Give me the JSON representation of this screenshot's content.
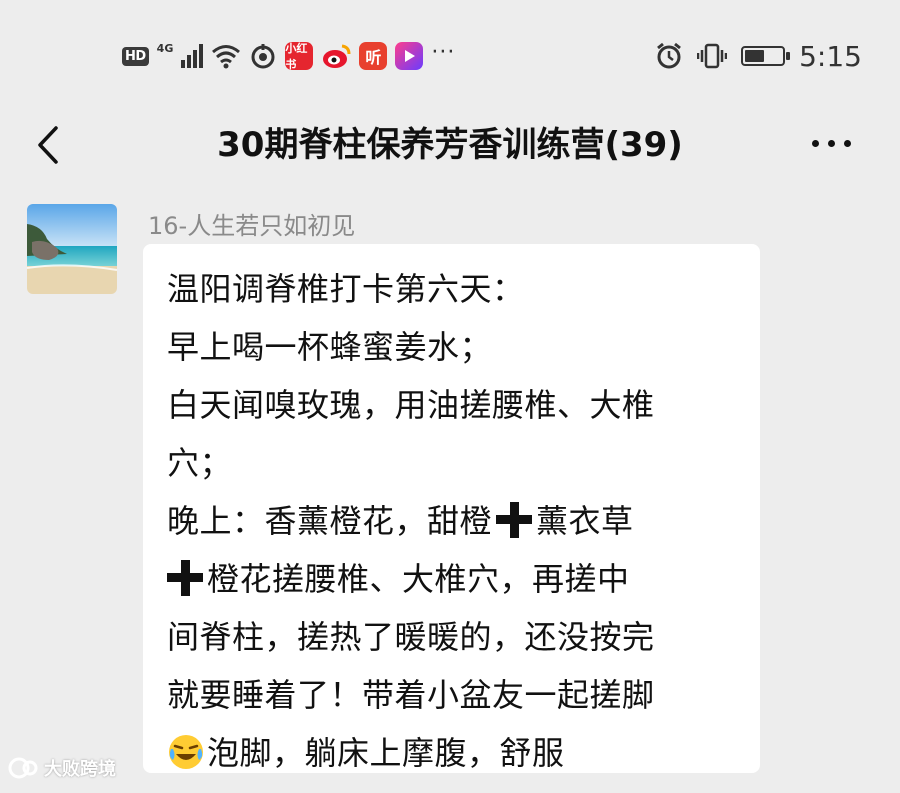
{
  "status_bar": {
    "hd_label": "HD",
    "network_label": "4G",
    "icons": [
      "signal-icon",
      "wifi-icon",
      "hotspot-icon",
      "app-xiaohongshu-icon",
      "weibo-icon",
      "listen-icon",
      "video-app-icon",
      "more-notifications-icon",
      "alarm-icon",
      "vibrate-icon",
      "battery-icon"
    ],
    "app_labels": [
      "小红书",
      "听"
    ],
    "overflow": "···",
    "battery_level": 0.55,
    "time": "5:15"
  },
  "header": {
    "back_icon": "chevron-left-icon",
    "title": "30期脊柱保养芳香训练营(39)",
    "more_icon": "more-dots-icon"
  },
  "message": {
    "avatar": "beach-avatar",
    "sender": "16-人生若只如初见",
    "lines": [
      "温阳调脊椎打卡第六天：",
      "早上喝一杯蜂蜜姜水；",
      "白天闻嗅玫瑰，用油搓腰椎、大椎",
      "穴；",
      "晚上：香薰橙花，甜橙",
      "薰衣草",
      "橙花搓腰椎、大椎穴，再搓中",
      "间脊柱，搓热了暖暖的，还没按完",
      "就要睡着了！带着小盆友一起搓脚",
      "泡脚，躺床上摩腹，舒服"
    ]
  },
  "watermark": "大败跨境",
  "colors": {
    "background": "#ededed",
    "bubble": "#ffffff",
    "sender_text": "#8a8a8a"
  }
}
